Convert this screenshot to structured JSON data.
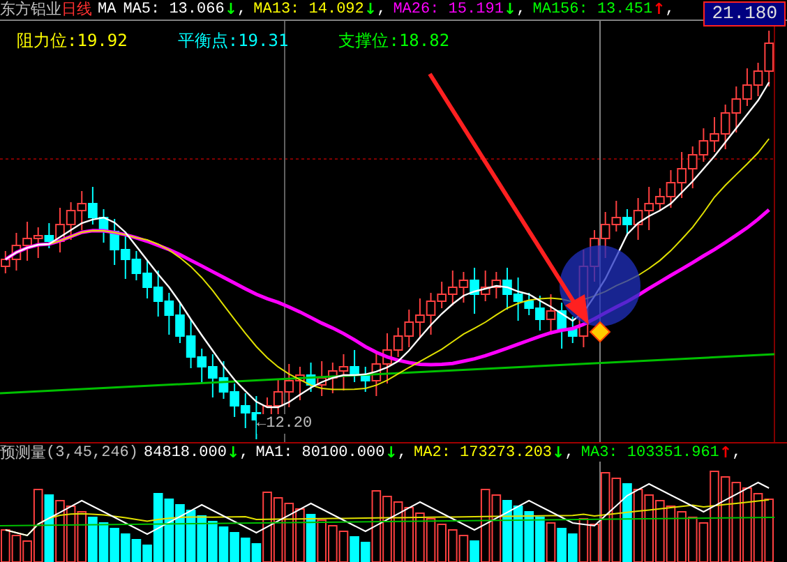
{
  "header": {
    "stock": "东方铝业",
    "period": "日线",
    "indicator": "MA",
    "items": [
      {
        "label": "MA5: 13.066",
        "arrow": {
          "symbol": "↓",
          "color": "#00ff00"
        },
        "sep": ",",
        "color": "#ffffff"
      },
      {
        "label": "MA13: 14.092",
        "arrow": {
          "symbol": "↓",
          "color": "#00ff00"
        },
        "sep": ",",
        "color": "#ffff00"
      },
      {
        "label": "MA26: 15.191",
        "arrow": {
          "symbol": "↓",
          "color": "#00ff00"
        },
        "sep": ",",
        "color": "#ff00ff"
      },
      {
        "label": "MA156: 13.451",
        "arrow": {
          "symbol": "↑",
          "color": "#ff0000"
        },
        "sep": ",",
        "color": "#00ff00"
      }
    ]
  },
  "price_tag": "21.180",
  "levels": [
    {
      "label": "阻力位:19.92",
      "color": "#ffff00"
    },
    {
      "label": "平衡点:19.31",
      "color": "#00ffff"
    },
    {
      "label": "支撑位:18.82",
      "color": "#00ff00"
    }
  ],
  "low_label": {
    "arrow": "←",
    "value": "12.20"
  },
  "volume_header": {
    "title": "预测量",
    "params": "(3,45,246)",
    "items": [
      {
        "label": "84818.000",
        "arrow": {
          "symbol": "↓",
          "color": "#00ff00"
        },
        "sep": ",",
        "color": "#ffffff"
      },
      {
        "label": "MA1: 80100.000",
        "arrow": {
          "symbol": "↓",
          "color": "#00ff00"
        },
        "sep": ",",
        "color": "#ffffff"
      },
      {
        "label": "MA2: 173273.203",
        "arrow": {
          "symbol": "↓",
          "color": "#00ff00"
        },
        "sep": ",",
        "color": "#ffff00"
      },
      {
        "label": "MA3: 103351.961",
        "arrow": {
          "symbol": "↑",
          "color": "#ff0000"
        },
        "sep": ",",
        "color": "#00ff00"
      }
    ]
  }
}
